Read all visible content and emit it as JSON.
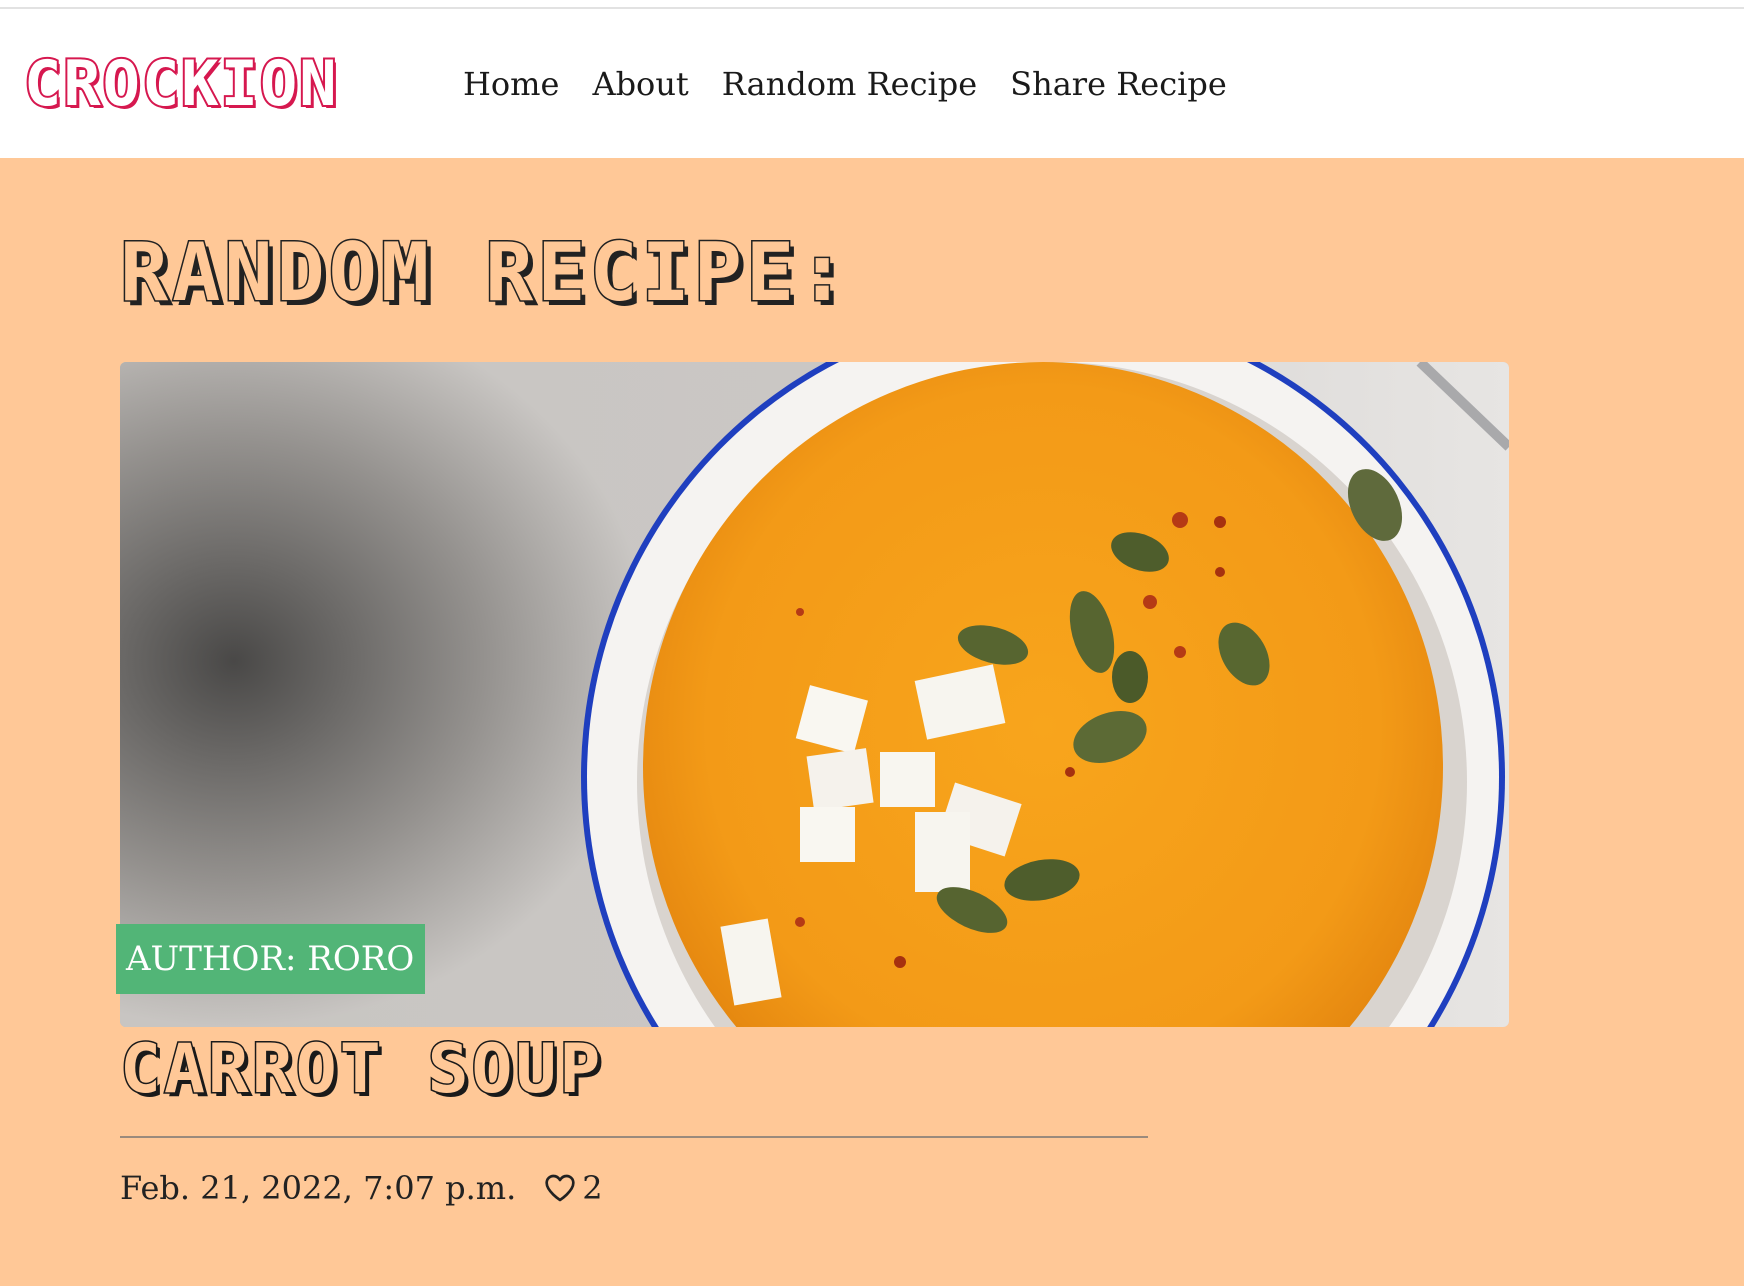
{
  "brand": {
    "name": "CROCKION",
    "color": "#d6184f"
  },
  "nav": {
    "items": [
      {
        "label": "Home"
      },
      {
        "label": "About"
      },
      {
        "label": "Random Recipe"
      },
      {
        "label": "Share Recipe"
      }
    ]
  },
  "page": {
    "heading": "RANDOM RECIPE:",
    "background": "#ffc897"
  },
  "recipe": {
    "image_icon": "soup-photo",
    "author_label": "AUTHOR: RORO",
    "author_badge_color": "#52b577",
    "title": "CARROT SOUP",
    "date": "Feb. 21, 2022, 7:07 p.m.",
    "like_icon": "heart-outline-icon",
    "likes": "2"
  }
}
